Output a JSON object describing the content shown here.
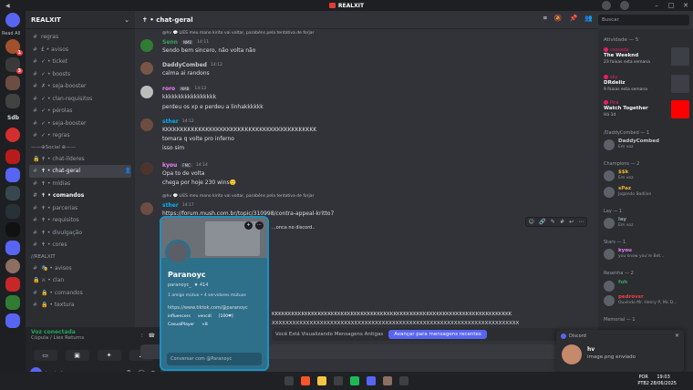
{
  "titlebar": {
    "app": "REALXIT",
    "left_arrow": "◀"
  },
  "rail": {
    "read_all": "Read All",
    "sdb": "Sdb"
  },
  "guild": {
    "name": "REALXIT"
  },
  "channels": [
    {
      "icon": "#",
      "label": "regras"
    },
    {
      "icon": "#",
      "label": "£ • avisos"
    },
    {
      "icon": "#",
      "label": "✓ • ticket"
    },
    {
      "icon": "#",
      "label": "✓ • boosts"
    },
    {
      "icon": "#",
      "label": "✗ • seja-booster"
    },
    {
      "icon": "#",
      "label": "✓ • clan-requisitos"
    },
    {
      "icon": "#",
      "label": "✓ • pérolas"
    },
    {
      "icon": "#",
      "label": "✓ • seja-booster"
    },
    {
      "icon": "#",
      "label": "✓ • regras"
    }
  ],
  "category_social": "——⊕Social ⊕——",
  "social_channels": [
    {
      "icon": "🔒",
      "label": "✝ • chat-líderes"
    },
    {
      "icon": "#",
      "label": "✝ • chat-geral"
    },
    {
      "icon": "#",
      "label": "✝ • mídias"
    },
    {
      "icon": "#",
      "label": "✝ • comandos"
    },
    {
      "icon": "#",
      "label": "✝ • parcerias"
    },
    {
      "icon": "#",
      "label": "✝ • requisitos"
    },
    {
      "icon": "#",
      "label": "✝ • divulgação"
    },
    {
      "icon": "#",
      "label": "✝ • cores"
    }
  ],
  "category_realxit": "//REALXIT",
  "realxit_channels": [
    {
      "icon": "#",
      "label": "🎭 • avisos"
    },
    {
      "icon": "🔒",
      "label": "⚔ • clan"
    },
    {
      "icon": "#",
      "label": "🔒 • comandos"
    },
    {
      "icon": "#",
      "label": "🔒 • textura"
    }
  ],
  "voice": {
    "status": "Voz conectada",
    "channel": "Cúpula / Lies Returns"
  },
  "user": {
    "name": "lossivel"
  },
  "chat": {
    "channel_title": "✝ • chat-geral",
    "search_placeholder": "Buscar",
    "messages": [
      {
        "reply": "@hv 💬 LIES  meu mano kirito vai voltar, parabéns pela tentativa de forjar",
        "name": "Senn",
        "tag": "NMB",
        "time": "14:11",
        "lines": [
          "Sendo bem sincero, não volta não"
        ],
        "color": "#3ba55d"
      },
      {
        "name": "DaddyCombed",
        "tag": "",
        "time": "14:12",
        "lines": [
          "calma ai randons"
        ],
        "color": "#c4c9ce"
      },
      {
        "name": "roro",
        "tag": "NMB",
        "time": "14:12",
        "lines": [
          "kkkkkkkkkkkkkkkkk",
          "perdeu os xp e perdeu a linhakkkkkk"
        ],
        "color": "#f47fff"
      },
      {
        "name": "sther",
        "tag": "",
        "time": "14:12",
        "lines": [
          "KKKKKKKKKKKKKKKKKKKKKKKKKKKKKKKKKKKKKKKKKKK",
          "tomara q volte pro inferno",
          "isso sim"
        ],
        "color": "#00aff4"
      },
      {
        "name": "kyou",
        "tag": "FMC",
        "time": "14:14",
        "lines": [
          "Opa to de volta",
          "chega por hoje 230 wins🙂"
        ],
        "color": "#f47fff"
      },
      {
        "reply": "@hv 💬 LIES  meu mano kirito vai voltar, parabéns pela tentativa de forjar",
        "name": "sther",
        "tag": "",
        "time": "14:17",
        "lines": [
          "https://forum.mush.com.br/topic/310998/contra-appeal-kritto7"
        ],
        "color": "#00aff4",
        "link": true
      }
    ],
    "partial_lines": [
      "...onca no discord..",
      "KKKKKKKKKKKKKKKKKKKKKKKKKKKKKKKKKKKKKKKKKKKKKKKKKKKKKKKKKKKKKKKKKKKKKKKKK",
      "XXXXXXXXXXXXXXXXXXXXXXXXXXXXXXXXXXXXXXXXXXXXXXXXXXXXXXXXXXXXXXXXXXXXXXXX"
    ],
    "old_messages": "Você Está Visualizando Mensagens Antigas",
    "jump_label": "Avançar para mensagens recentes"
  },
  "popout": {
    "display_name": "Paranoyc",
    "handle": "paranoyc_",
    "handle_badge": "♦ 414",
    "meta": "1 amigo mútuo  •  4 servidores mútuos",
    "link": "https://www.tiktok.com/@paranoyc",
    "roles": [
      "influencers",
      "vencdl",
      "[100❤]",
      "CasualPlayer",
      "+8"
    ],
    "message_placeholder": "Conversar com @Paranoyc"
  },
  "activity": {
    "header": "Atividade — 5",
    "cards": [
      {
        "user": "cassada",
        "title": "The Weeknd",
        "sub": "23 faixas esta semana"
      },
      {
        "user": "sky",
        "title": "DRdeliz",
        "sub": "9 faixas esta semana"
      },
      {
        "user": "Pira",
        "title": "Watch Together",
        "sub": "Há 1d"
      }
    ],
    "members": [
      {
        "group": "/DaddyCombed — 1"
      },
      {
        "name": "DaddyCombed",
        "sub": "Em voz",
        "color": "#c4c9ce"
      },
      {
        "group": "Champions — 2"
      },
      {
        "name": "$$k",
        "sub": "Em voz",
        "color": "#f0b232"
      },
      {
        "name": "sPaz",
        "sub": "Jogando Badlion",
        "color": "#f0b232"
      },
      {
        "group": "Lay — 1"
      },
      {
        "name": "lay",
        "sub": "Em voz",
        "color": "#949ba4"
      },
      {
        "group": "Stars — 1"
      },
      {
        "name": "kyou",
        "sub": "you know you're Bet...",
        "color": "#f47fff"
      },
      {
        "group": "Resenha — 2"
      },
      {
        "name": "fuh",
        "sub": "",
        "color": "#3ba55d"
      },
      {
        "name": "pedrovsr",
        "sub": "Ouvindo Mr. Henry P, Mc D...",
        "color": "#f23f43"
      },
      {
        "group": "Memorial — 1"
      }
    ]
  },
  "toast": {
    "app": "Discord",
    "name": "hv",
    "message": "image.png enviado"
  },
  "taskbar": {
    "lang_top": "POR",
    "lang_bottom": "PTB2",
    "time": "19:03",
    "date": "28/06/2025"
  }
}
